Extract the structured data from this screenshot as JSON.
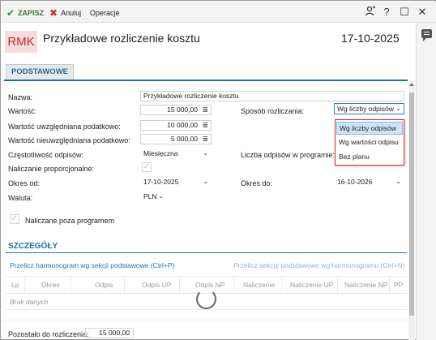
{
  "toolbar": {
    "save": "ZAPISZ",
    "cancel": "Anuluj",
    "operations": "Operacje",
    "icons": [
      "add-user-icon",
      "help-icon",
      "maximize-icon",
      "close-icon"
    ],
    "help_label": "?",
    "maximize_label": "☐",
    "close_label": "✕"
  },
  "header": {
    "badge": "RMK",
    "title": "Przykładowe rozliczenie kosztu",
    "date": "17-10-2025"
  },
  "tabs": [
    {
      "label": "PODSTAWOWE",
      "active": true
    }
  ],
  "form": {
    "name_label": "Nazwa:",
    "name_value": "Przykładowe rozliczenie kosztu",
    "value_label": "Wartość:",
    "value_value": "15 000,00",
    "tax_value_label": "Wartość uwzględniana podatkowo:",
    "tax_value_value": "10 000,00",
    "nontax_value_label": "Wartość nieuwzględniana podatkowo:",
    "nontax_value_value": "5 000,00",
    "frequency_label": "Częstotliwość odpisów:",
    "frequency_value": "Miesięczna",
    "proportional_label": "Naliczanie proporcjonalne:",
    "proportional_checked": true,
    "period_from_label": "Okres od:",
    "period_from_value": "17-10-2025",
    "currency_label": "Waluta:",
    "currency_value": "PLN",
    "outside_program_label": "Naliczane poza programem",
    "outside_program_checked": true,
    "settlement_method_label": "Sposób rozliczania:",
    "settlement_method_value": "Wg liczby odpisów",
    "settlement_method_options": [
      "Wg liczby odpisów",
      "Wg wartości odpisu",
      "Bez planu"
    ],
    "count_label": "Liczba odpisów w programie:",
    "period_to_label": "Okres do:",
    "period_to_value": "16-10-2026",
    "calc_icon": "≣",
    "chevron": "⌄"
  },
  "details": {
    "section_title": "SZCZEGÓŁY",
    "link_recalc_schedule": "Przelicz harmonogram wg sekcji podstawowe (Ctrl+P)",
    "link_recalc_basic": "Przelicz sekcję podstawowe wg harmonogramu (Ctrl+N)",
    "columns": [
      "Lp",
      "Okres",
      "Odpis",
      "Odpis UP",
      "Odpis NP",
      "Naliczenie",
      "Naliczenie UP",
      "Naliczenie NP",
      "PP"
    ],
    "no_data": "Brak danych"
  },
  "footer": {
    "remaining_label": "Pozostało do rozliczenia:",
    "remaining_value": "15 000,00"
  },
  "colors": {
    "accent": "#1f6fa8",
    "save_green": "#2e7d32",
    "cancel_red": "#d32f2f",
    "badge_bg": "#f6dcdc",
    "dropdown_border": "#d32f2f"
  }
}
